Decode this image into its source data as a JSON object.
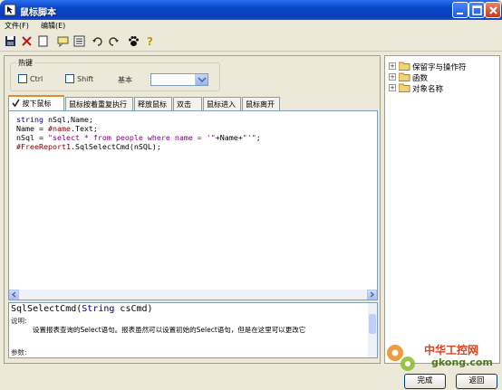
{
  "window": {
    "title": "鼠标脚本"
  },
  "menu": {
    "items": [
      "文件(F)",
      "编辑(E)"
    ]
  },
  "toolbar": {
    "buttons": [
      "save-icon",
      "delete-icon",
      "new-icon",
      "comment-icon",
      "list-icon",
      "undo-icon",
      "redo-icon",
      "paw-icon",
      "help-icon"
    ]
  },
  "hotkey": {
    "legend": "热键",
    "ctrl_label": "Ctrl",
    "shift_label": "Shift",
    "base_label": "基本",
    "base_value": ""
  },
  "tabs": [
    "按下鼠标",
    "鼠标按着重复执行",
    "释放鼠标",
    "双击",
    "鼠标进入",
    "鼠标离开"
  ],
  "code": {
    "line1_kw": "string",
    "line1_rest": " nSql,Name;",
    "line2_plain": "Name = ",
    "line2_obj": "#name",
    "line2_rest": ".Text;",
    "line3_plain": "nSql = ",
    "line3_str": "\"select * from people where name = '\"",
    "line3_rest1": "+Name+",
    "line3_str2": "\"'\"",
    "line3_rest2": ";",
    "line4_obj": "#FreeReport1",
    "line4_rest": ".SqlSelectCmd(nSQL);"
  },
  "help": {
    "signature_func": "SqlSelectCmd(",
    "signature_type": "String",
    "signature_rest": " csCmd)",
    "desc_label": "说明:",
    "desc_text": "设置报表查询的Select语句。报表虽然可以设置初始的Select语句，但是在这里可以更改它",
    "params_label": "参数:"
  },
  "tree": {
    "items": [
      "保留字与操作符",
      "函数",
      "对象名称"
    ]
  },
  "footer": {
    "ok_label": "完成",
    "back_label": "返回"
  },
  "watermark": {
    "brand": "中华工控网",
    "domain": "gkong.com"
  }
}
